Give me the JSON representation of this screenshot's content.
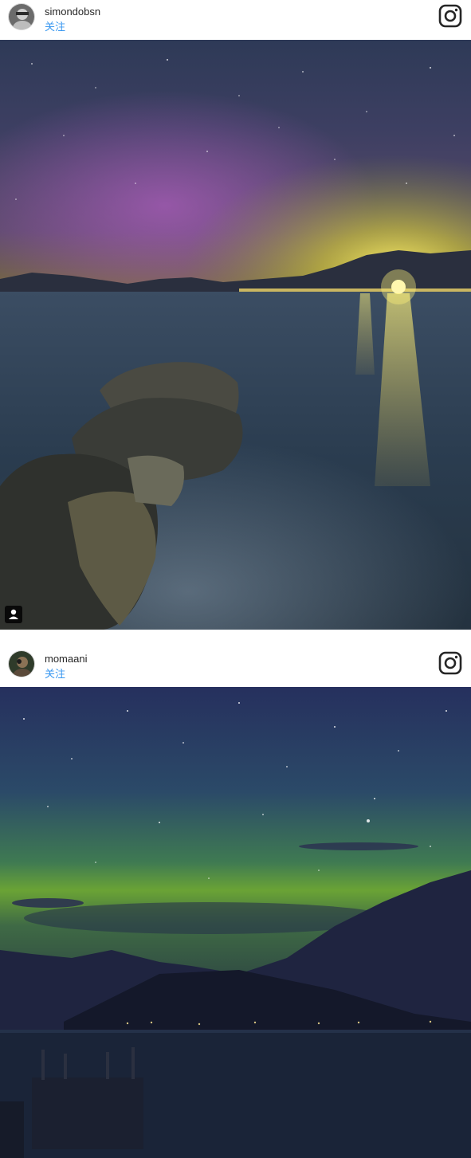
{
  "posts": [
    {
      "username": "simondobsn",
      "follow_label": "关注",
      "icons": {
        "brand": "instagram-icon",
        "tag": "user-tag-icon"
      }
    },
    {
      "username": "momaani",
      "follow_label": "关注",
      "icons": {
        "brand": "instagram-icon"
      }
    }
  ],
  "colors": {
    "follow_link": "#3897f0",
    "text": "#262626",
    "background": "#ffffff"
  }
}
